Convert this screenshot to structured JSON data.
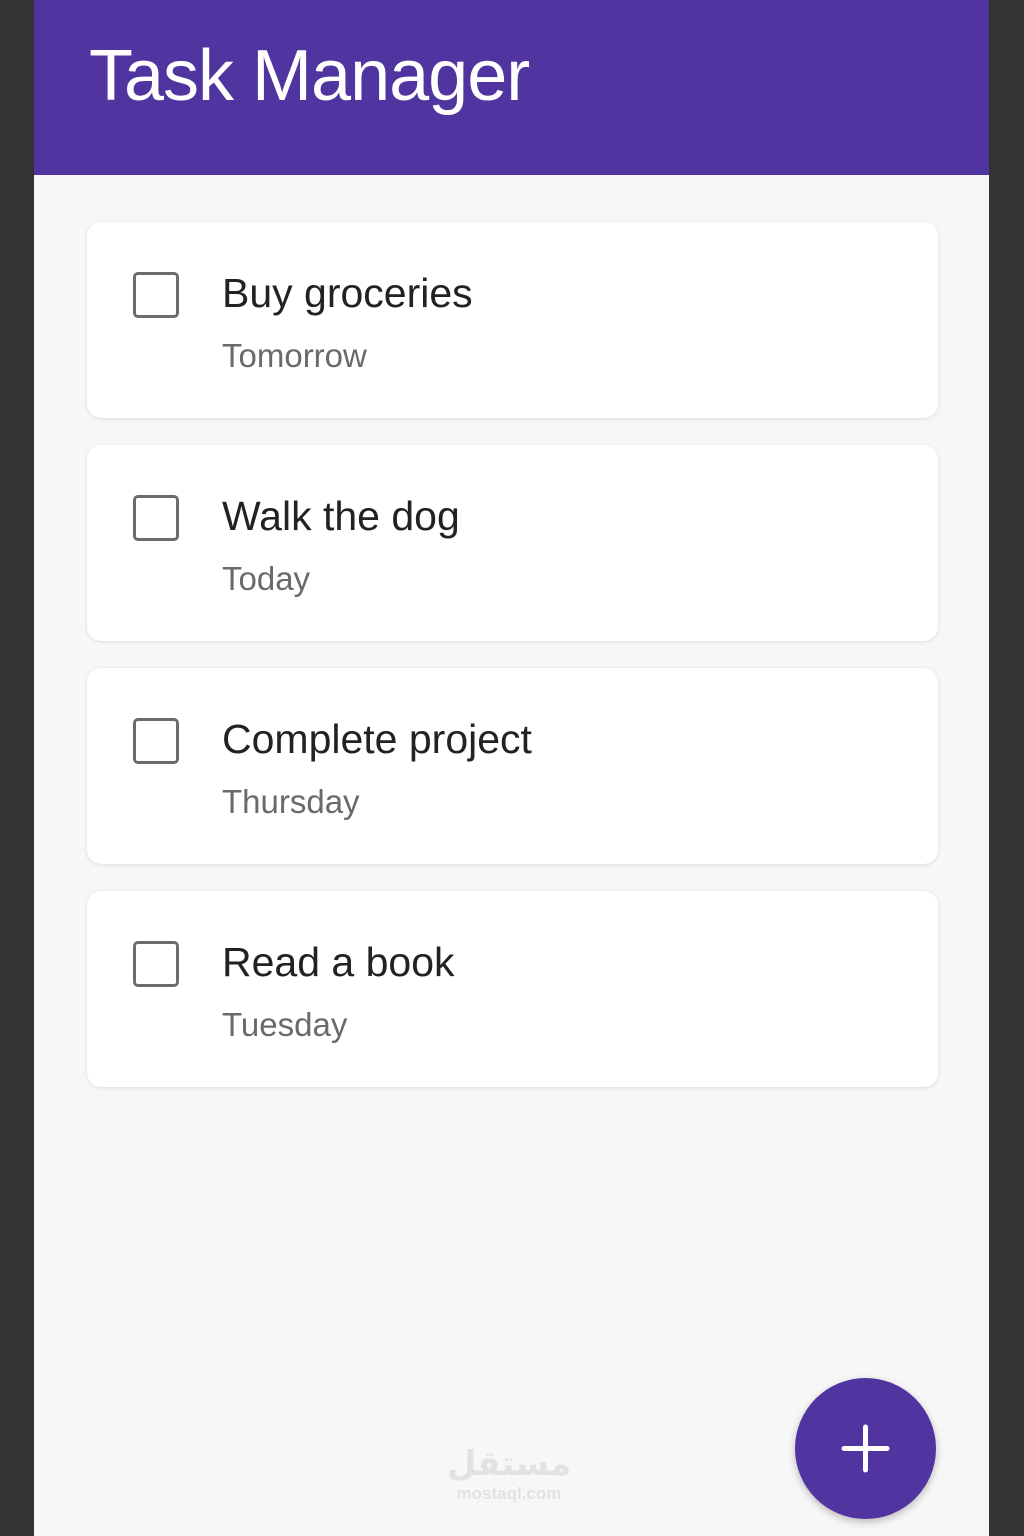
{
  "app_bar": {
    "title": "Task Manager"
  },
  "tasks": [
    {
      "title": "Buy groceries",
      "due": "Tomorrow",
      "checked": false
    },
    {
      "title": "Walk the dog",
      "due": "Today",
      "checked": false
    },
    {
      "title": "Complete project",
      "due": "Thursday",
      "checked": false
    },
    {
      "title": "Read a book",
      "due": "Tuesday",
      "checked": false
    }
  ],
  "watermark": {
    "mark": "مستقل",
    "text": "mostaql.com"
  },
  "fab": {
    "icon": "plus-icon"
  },
  "colors": {
    "primary": "#5034a0",
    "background": "#f7f7f7",
    "card": "#ffffff",
    "title_text": "#222222",
    "secondary_text": "#6a6a6a"
  }
}
